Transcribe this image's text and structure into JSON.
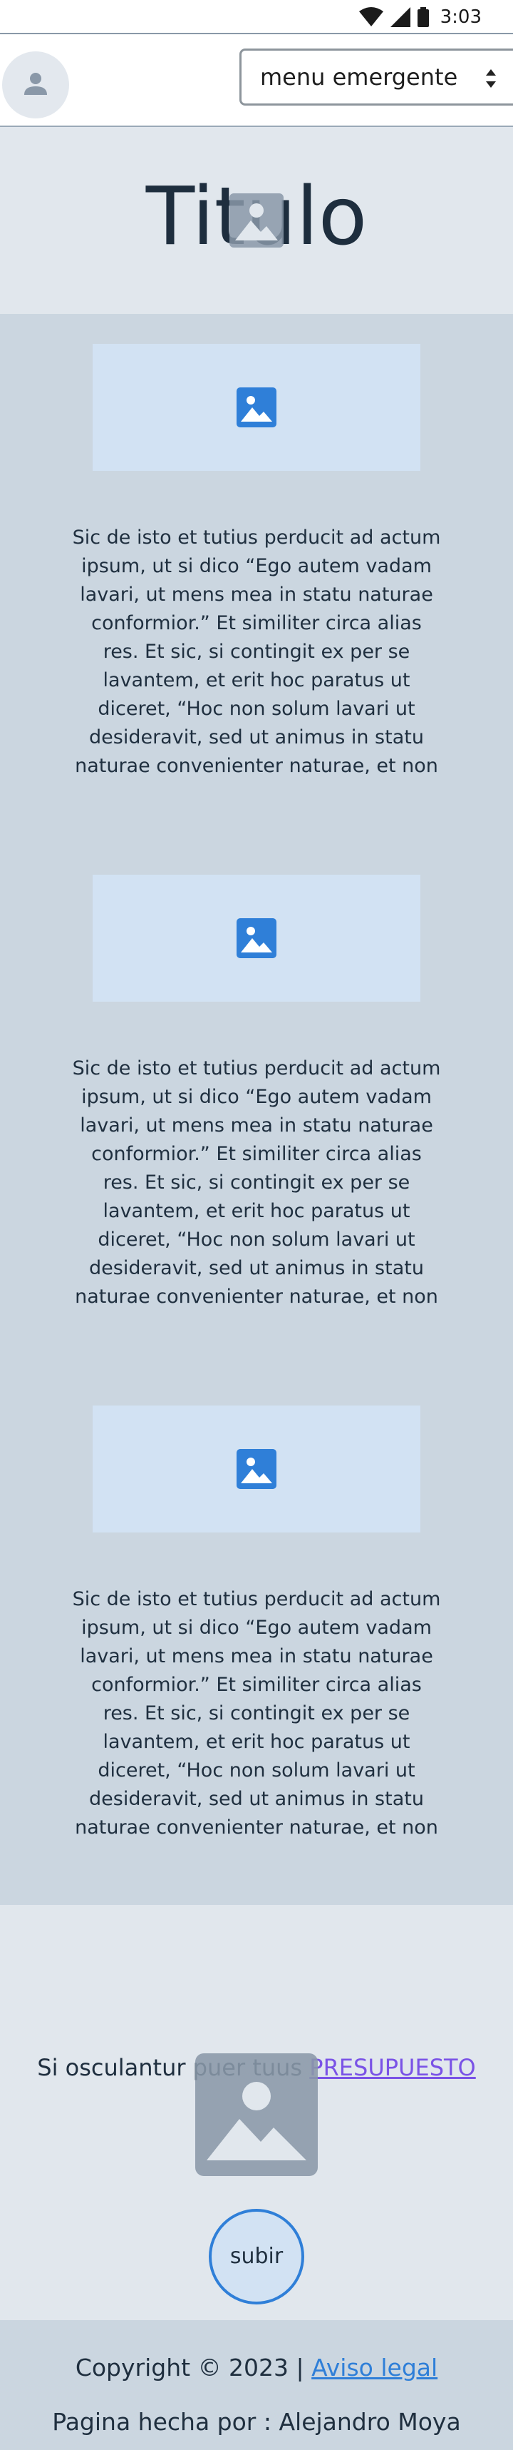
{
  "status_bar": {
    "time": "3:03"
  },
  "header": {
    "menu_label": "menu emergente"
  },
  "hero": {
    "title": "Titulo"
  },
  "articles": [
    {
      "text": "Sic de isto et tutius perducit ad actum ipsum, ut si dico “Ego autem vadam lavari, ut mens mea in statu naturae conformior.” Et similiter circa alias res. Et sic, si contingit ex per se lavantem, et erit hoc paratus ut diceret, “Hoc non solum lavari ut desideravit, sed ut animus in statu naturae convenienter naturae, et non"
    },
    {
      "text": "Sic de isto et tutius perducit ad actum ipsum, ut si dico “Ego autem vadam lavari, ut mens mea in statu naturae conformior.” Et similiter circa alias res. Et sic, si contingit ex per se lavantem, et erit hoc paratus ut diceret, “Hoc non solum lavari ut desideravit, sed ut animus in statu naturae convenienter naturae, et non"
    },
    {
      "text": "Sic de isto et tutius perducit ad actum ipsum, ut si dico “Ego autem vadam lavari, ut mens mea in statu naturae conformior.” Et similiter circa alias res. Et sic, si contingit ex per se lavantem, et erit hoc paratus ut diceret, “Hoc non solum lavari ut desideravit, sed ut animus in statu naturae convenienter naturae, et non"
    }
  ],
  "cta": {
    "text": "Si osculantur puer tuus ",
    "link": "PRESUPUESTO"
  },
  "up_button": {
    "label": "subir"
  },
  "footer": {
    "copyright": "Copyright © 2023  | ",
    "legal_link": " Aviso legal",
    "credit": "Pagina hecha por : Alejandro Moya"
  },
  "colors": {
    "accent_blue": "#2f7fd8",
    "link_purple": "#7a53e6",
    "section_light": "#e1e7ed",
    "section_mid": "#cbd6e0",
    "image_placeholder": "#d2e2f3"
  }
}
